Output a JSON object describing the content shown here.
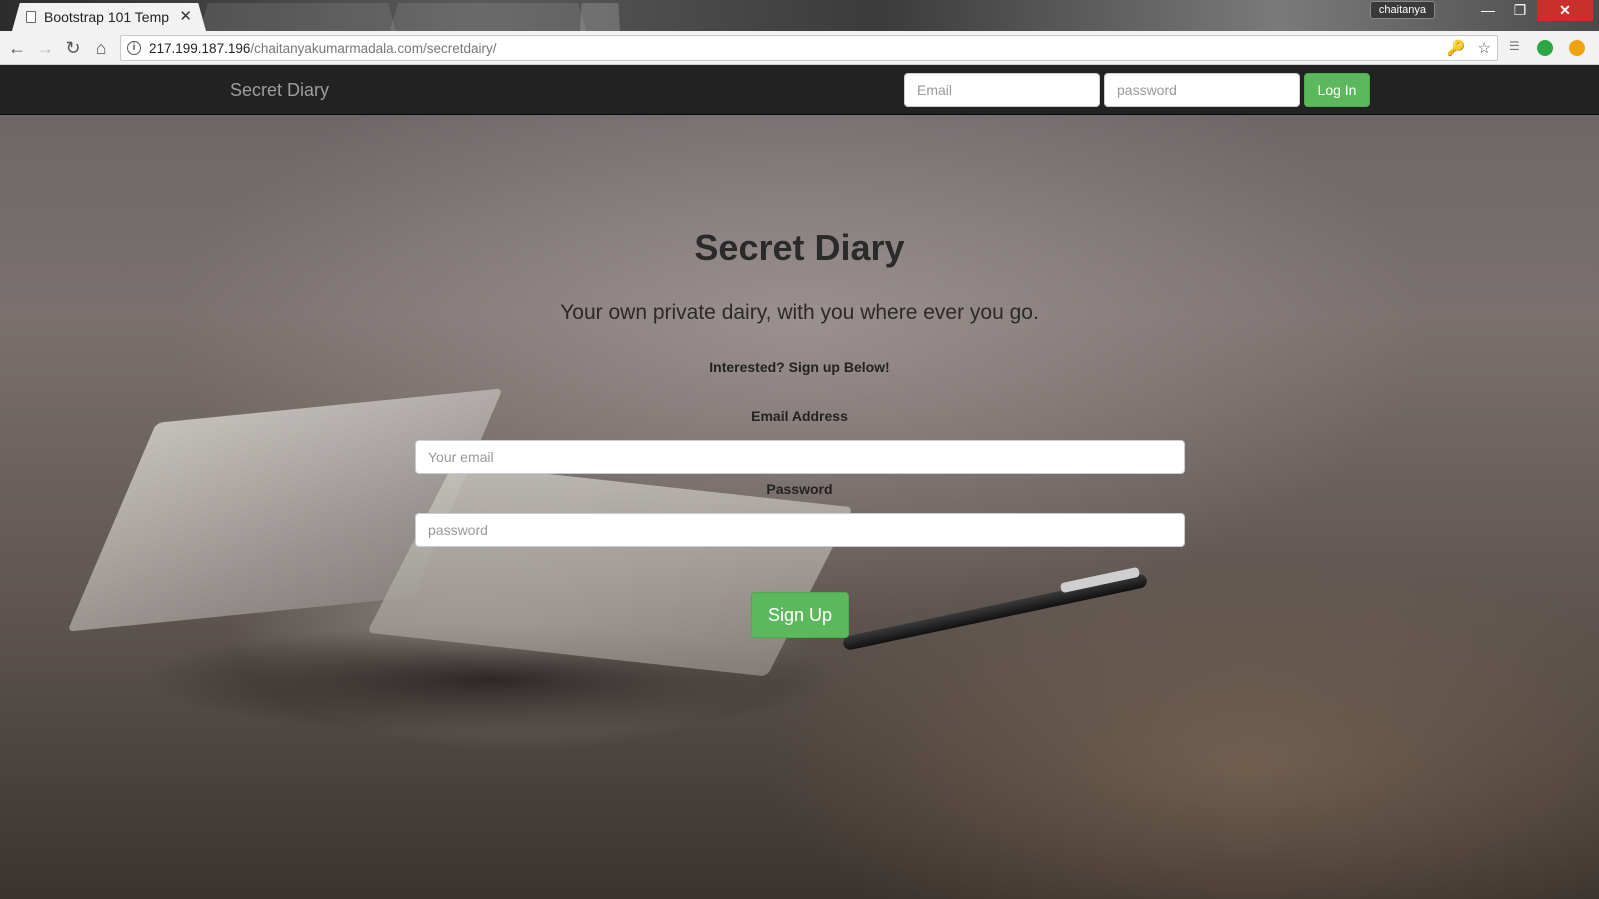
{
  "browser": {
    "active_tab_title": "Bootstrap 101 Temp",
    "tab_close": "✕",
    "profile_name": "chaitanya",
    "url_host": "217.199.187.196",
    "url_path": "/chaitanyakumarmadala.com/secretdairy/",
    "icons": {
      "back": "←",
      "forward": "→",
      "reload": "↻",
      "home": "⌂",
      "info": "i",
      "key": "🔑",
      "star": "☆",
      "minimize": "—",
      "maximize": "❐",
      "close": "✕"
    }
  },
  "navbar": {
    "brand": "Secret Diary",
    "email_placeholder": "Email",
    "password_placeholder": "password",
    "login_label": "Log In"
  },
  "hero": {
    "title": "Secret Diary",
    "subtitle": "Your own private dairy, with you where ever you go.",
    "cta": "Interested? Sign up Below!",
    "email_label": "Email Address",
    "email_placeholder": "Your email",
    "password_label": "Password",
    "password_placeholder": "password",
    "signup_label": "Sign Up"
  },
  "colors": {
    "navbar_bg": "#222222",
    "success": "#5cb85c"
  }
}
